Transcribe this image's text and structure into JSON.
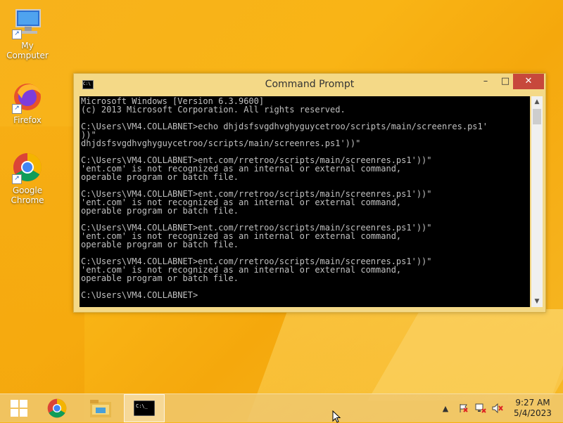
{
  "desktop": {
    "icons": [
      {
        "label": "My Computer"
      },
      {
        "label": "Firefox"
      },
      {
        "label": "Google Chrome"
      }
    ]
  },
  "window": {
    "title": "Command Prompt",
    "controls": {
      "minimize": "–",
      "maximize": "□",
      "close": "✕"
    },
    "console_lines": [
      "Microsoft Windows [Version 6.3.9600]",
      "(c) 2013 Microsoft Corporation. All rights reserved.",
      "",
      "C:\\Users\\VM4.COLLABNET>echo dhjdsfsvgdhvghyguycetroo/scripts/main/screenres.ps1'",
      "))\"",
      "dhjdsfsvgdhvghyguycetroo/scripts/main/screenres.ps1'))\"",
      "",
      "C:\\Users\\VM4.COLLABNET>ent.com/rretroo/scripts/main/screenres.ps1'))\"",
      "'ent.com' is not recognized as an internal or external command,",
      "operable program or batch file.",
      "",
      "C:\\Users\\VM4.COLLABNET>ent.com/rretroo/scripts/main/screenres.ps1'))\"",
      "'ent.com' is not recognized as an internal or external command,",
      "operable program or batch file.",
      "",
      "C:\\Users\\VM4.COLLABNET>ent.com/rretroo/scripts/main/screenres.ps1'))\"",
      "'ent.com' is not recognized as an internal or external command,",
      "operable program or batch file.",
      "",
      "C:\\Users\\VM4.COLLABNET>ent.com/rretroo/scripts/main/screenres.ps1'))\"",
      "'ent.com' is not recognized as an internal or external command,",
      "operable program or batch file.",
      "",
      "C:\\Users\\VM4.COLLABNET>"
    ]
  },
  "taskbar": {
    "items": [
      {
        "icon": "windows-start-icon"
      },
      {
        "icon": "chrome-icon"
      },
      {
        "icon": "file-explorer-icon"
      },
      {
        "icon": "command-prompt-icon"
      }
    ],
    "clock": {
      "time": "9:27 AM",
      "date": "5/4/2023"
    }
  },
  "colors": {
    "close_button": "#c7483c",
    "console_bg": "#000000",
    "console_fg": "#c0c0c0"
  }
}
